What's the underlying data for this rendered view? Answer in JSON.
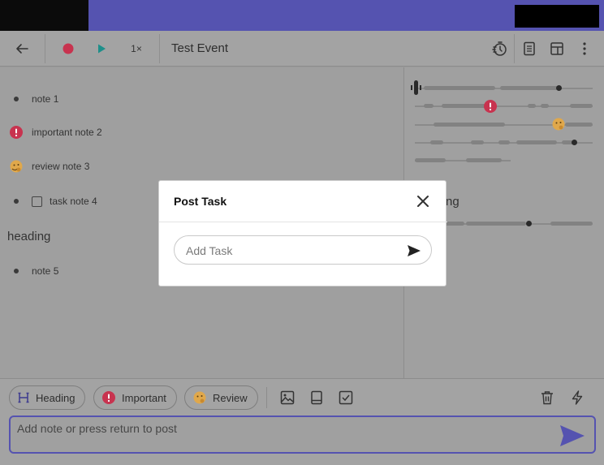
{
  "toolbar": {
    "title": "Test Event",
    "speed": "1×",
    "icons": [
      "back-arrow-icon",
      "record-icon",
      "play-icon",
      "timer-icon",
      "document-icon",
      "layout-icon",
      "more-vertical-icon"
    ]
  },
  "notes": [
    {
      "text": "note 1",
      "kind": "plain"
    },
    {
      "text": "important note 2",
      "kind": "important"
    },
    {
      "text": "review note 3",
      "kind": "review"
    },
    {
      "text": "task note 4",
      "kind": "task"
    },
    {
      "text": "note 5",
      "kind": "plain"
    }
  ],
  "heading": "heading",
  "timeline_heading": "ng",
  "modal": {
    "title": "Post Task",
    "task_placeholder": "Add Task"
  },
  "bottom": {
    "chips": [
      {
        "label": "Heading",
        "icon": "heading-icon"
      },
      {
        "label": "Important",
        "icon": "important-icon"
      },
      {
        "label": "Review",
        "icon": "review-emoji-icon"
      }
    ],
    "note_placeholder": "Add note or press return to post"
  },
  "colors": {
    "accent": "#5553b0",
    "record": "#c8334f",
    "play": "#1e8f8a",
    "important": "#c8334f",
    "review": "#e0a84b"
  }
}
